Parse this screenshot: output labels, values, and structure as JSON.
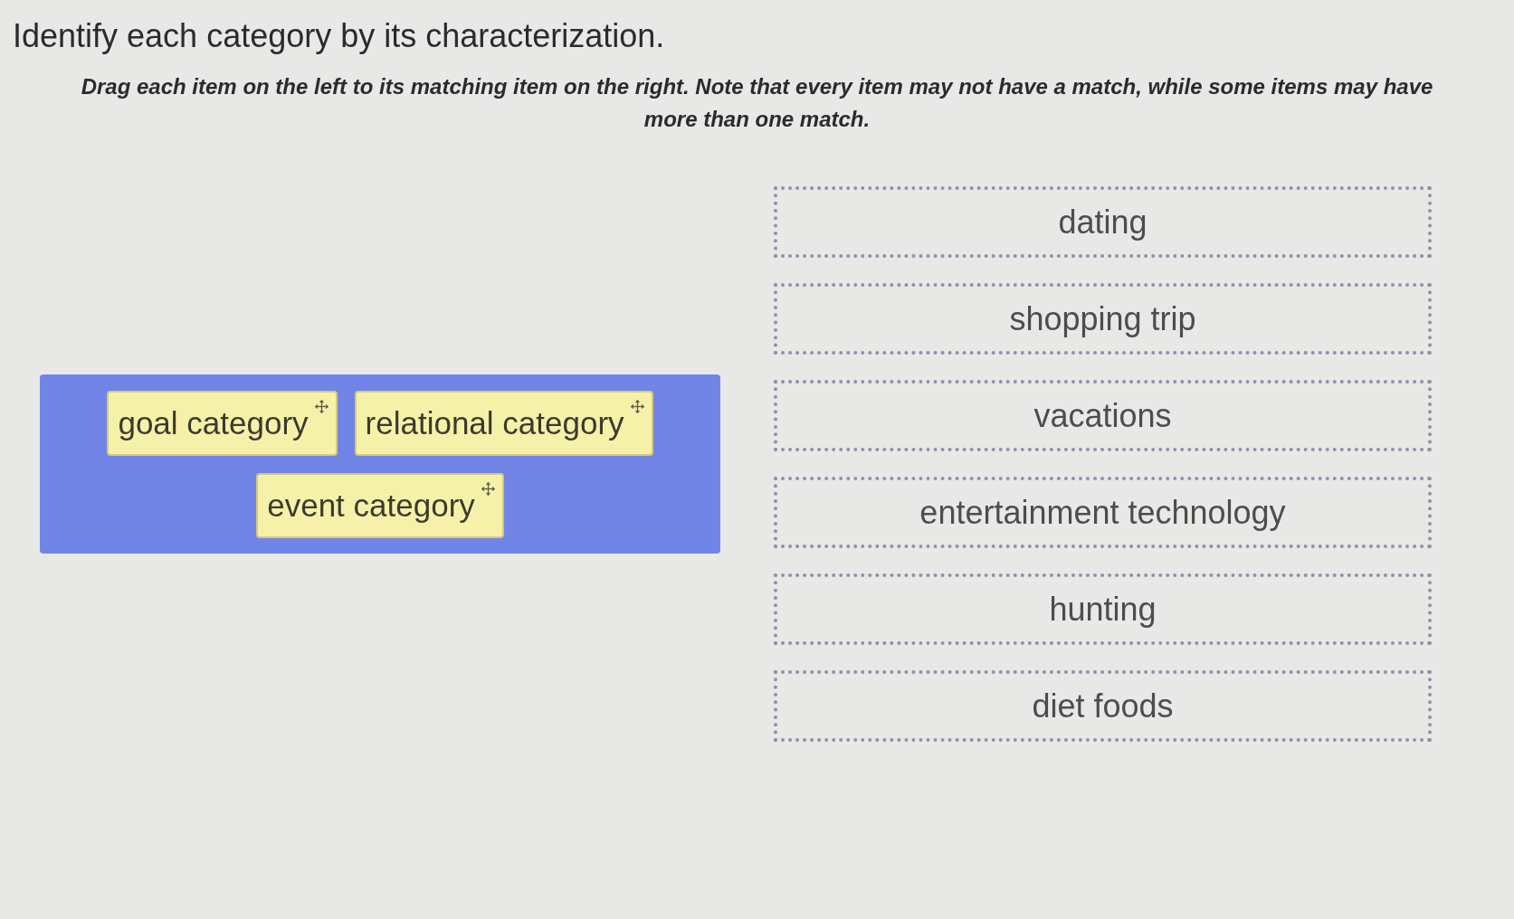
{
  "title": "Identify each category by its characterization.",
  "instructions": "Drag each item on the left to its matching item on the right. Note that every item may not have a match, while some items may have more than one match.",
  "choices": [
    {
      "label": "goal category"
    },
    {
      "label": "relational category"
    },
    {
      "label": "event category"
    }
  ],
  "targets": [
    {
      "label": "dating"
    },
    {
      "label": "shopping trip"
    },
    {
      "label": "vacations"
    },
    {
      "label": "entertainment technology"
    },
    {
      "label": "hunting"
    },
    {
      "label": "diet foods"
    }
  ]
}
